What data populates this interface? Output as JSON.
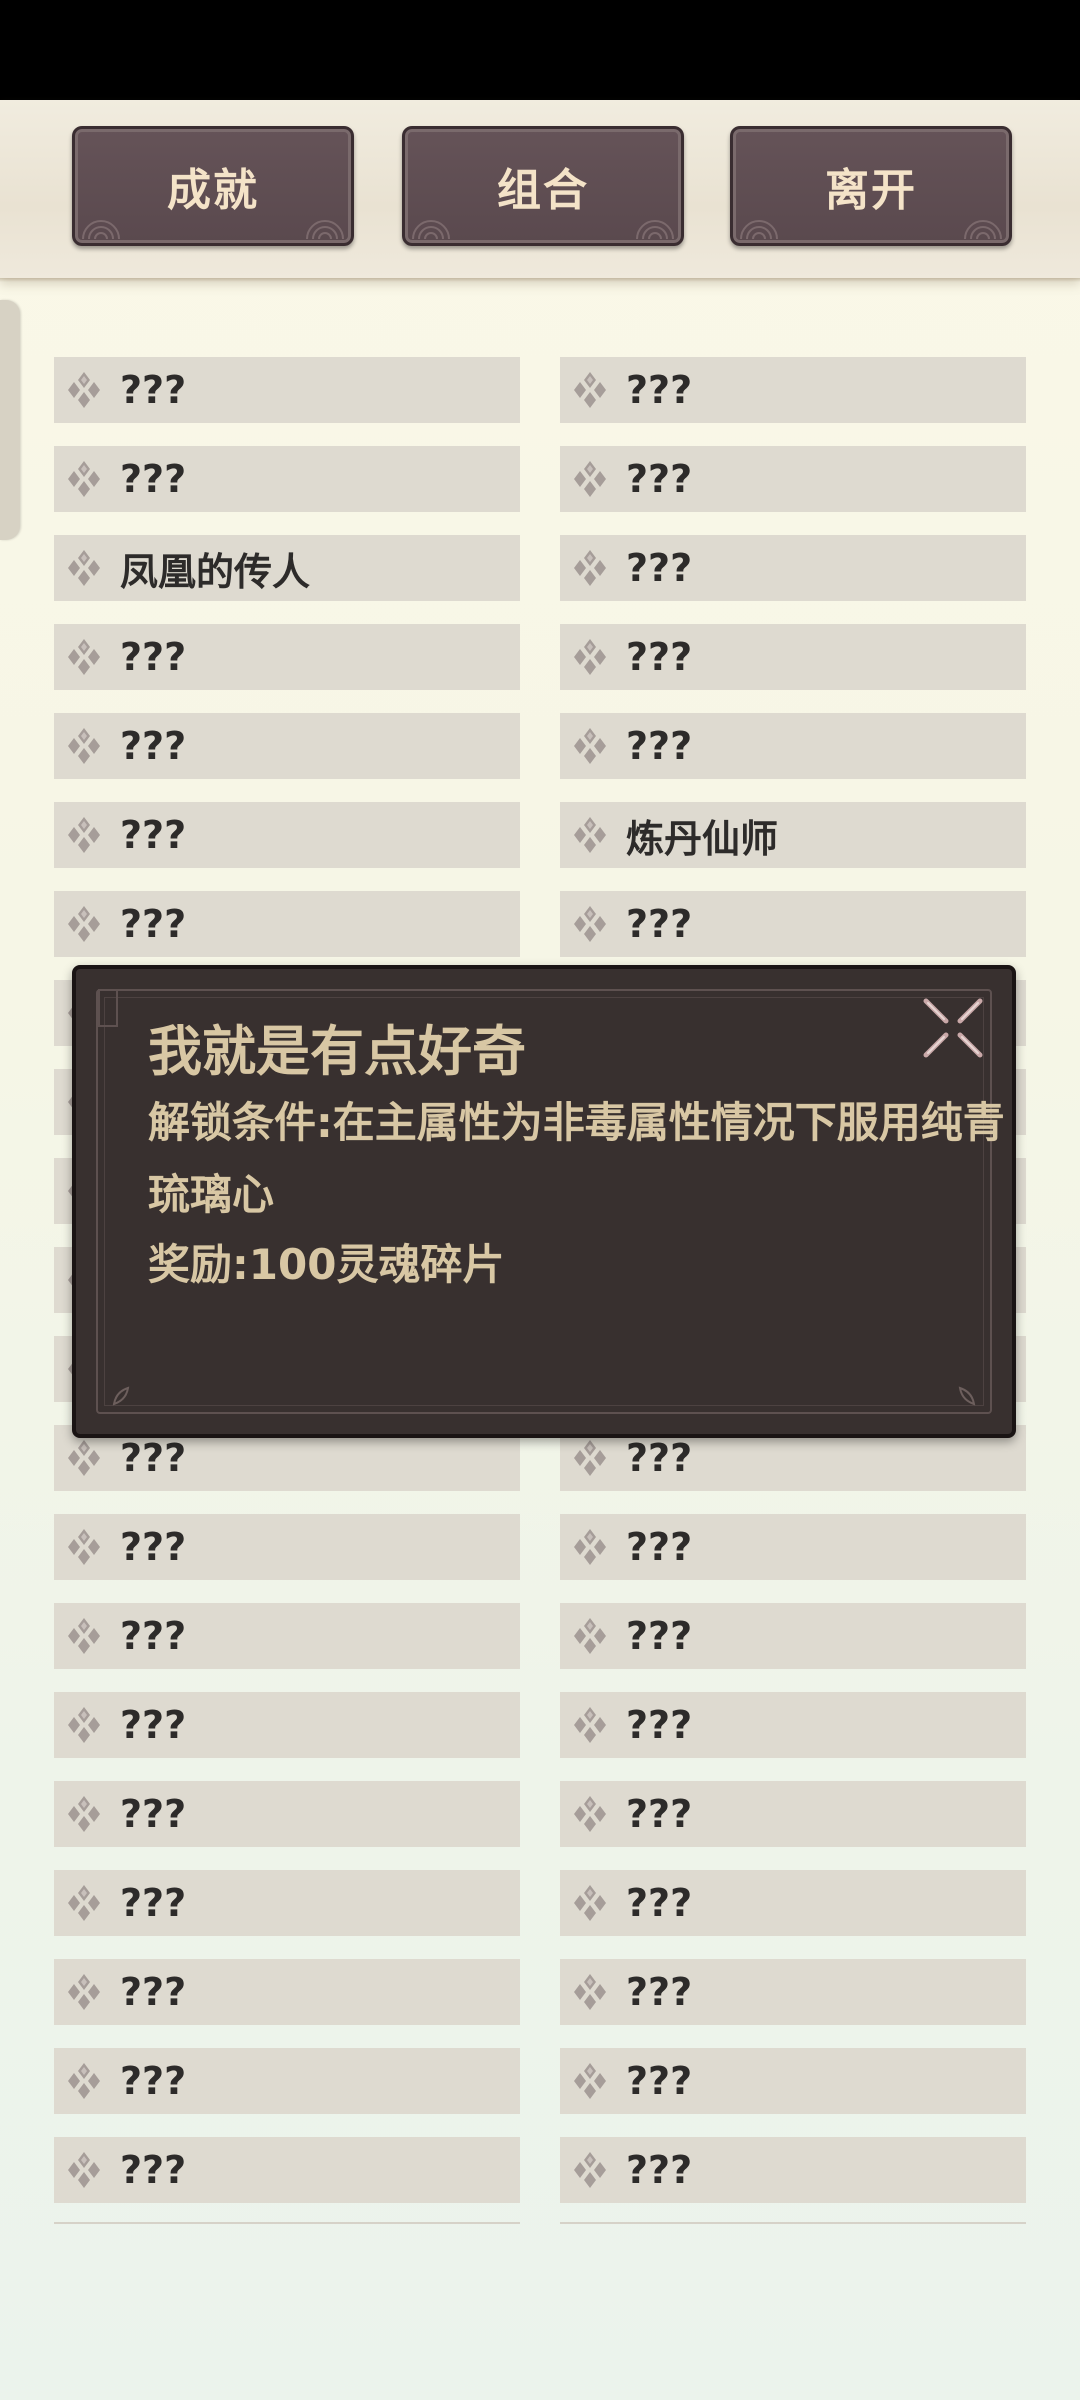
{
  "tabs": {
    "achievements": "成就",
    "combination": "组合",
    "leave": "离开"
  },
  "achievements": {
    "left": [
      "???",
      "???",
      "凤凰的传人",
      "???",
      "???",
      "???",
      "???",
      "???",
      "???",
      "???",
      "???",
      "???",
      "???",
      "???",
      "???",
      "???",
      "???",
      "???",
      "???",
      "???",
      "???"
    ],
    "right": [
      "???",
      "???",
      "???",
      "???",
      "???",
      "炼丹仙师",
      "???",
      "???",
      "???",
      "???",
      "???",
      "???",
      "???",
      "???",
      "???",
      "???",
      "???",
      "???",
      "???",
      "???",
      "???"
    ]
  },
  "popup": {
    "title": "我就是有点好奇",
    "description": "解锁条件:在主属性为非毒属性情况下服用纯青琉璃心",
    "reward": "奖励:100灵魂碎片"
  },
  "icons": {
    "row_icon": "diamond-cluster-icon",
    "close": "close-x-icon"
  },
  "colors": {
    "button_bg": "#5e4d52",
    "button_text": "#f4e3c8",
    "row_bg": "#dedad0",
    "popup_bg": "#38302f",
    "popup_text": "#d8c7a4"
  }
}
